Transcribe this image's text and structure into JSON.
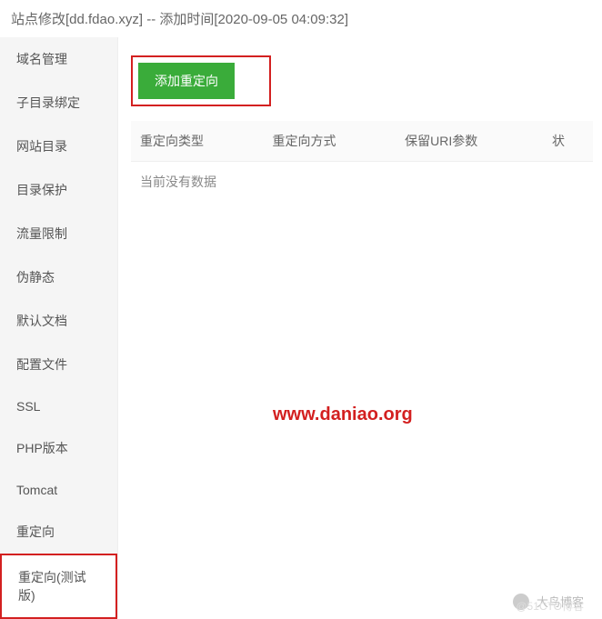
{
  "header": {
    "title": "站点修改[dd.fdao.xyz] -- 添加时间[2020-09-05 04:09:32]"
  },
  "sidebar": {
    "items": [
      {
        "label": "域名管理"
      },
      {
        "label": "子目录绑定"
      },
      {
        "label": "网站目录"
      },
      {
        "label": "目录保护"
      },
      {
        "label": "流量限制"
      },
      {
        "label": "伪静态"
      },
      {
        "label": "默认文档"
      },
      {
        "label": "配置文件"
      },
      {
        "label": "SSL"
      },
      {
        "label": "PHP版本"
      },
      {
        "label": "Tomcat"
      },
      {
        "label": "重定向"
      },
      {
        "label": "重定向(测试版)"
      }
    ]
  },
  "main": {
    "add_button_label": "添加重定向",
    "table": {
      "headers": {
        "col1": "重定向类型",
        "col2": "重定向方式",
        "col3": "保留URI参数",
        "col4": "状"
      },
      "empty_text": "当前没有数据"
    }
  },
  "watermark": {
    "url": "www.daniao.org",
    "footer1": "大鸟博客",
    "footer2": "@51CTO博客"
  }
}
